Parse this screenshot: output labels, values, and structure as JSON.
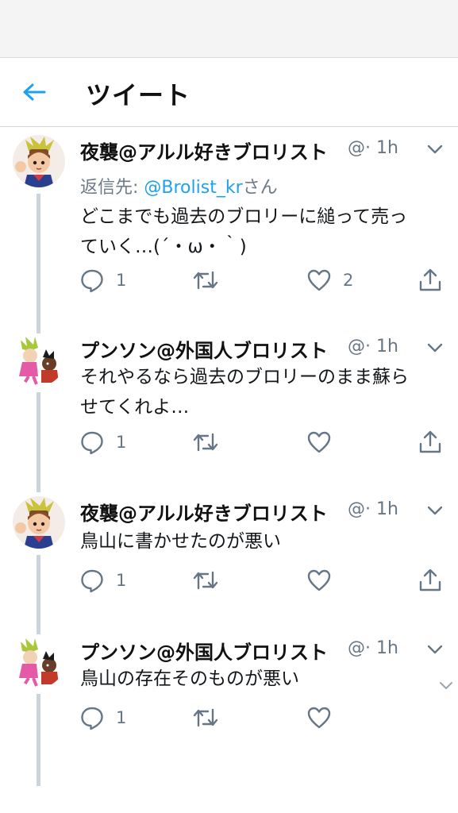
{
  "header": {
    "title": "ツイート"
  },
  "tweets": [
    {
      "name": "夜襲@アルル好きブロリスト",
      "handle": "@· 1h",
      "reply_prefix": "返信先: ",
      "reply_mention": "@Brolist_kr",
      "reply_suffix": "さん",
      "text_line1": "どこまでも過去のブロリーに縋って売っ",
      "text_line2": "ていく…(´・ω・｀)",
      "reply_count": "1",
      "retweet_count": "",
      "like_count": "2"
    },
    {
      "name": "プンソン@外国人ブロリスト",
      "handle": "@· 1h",
      "text_line1": "それやるなら過去のブロリーのまま蘇ら",
      "text_line2": "せてくれよ…",
      "reply_count": "1",
      "retweet_count": "",
      "like_count": ""
    },
    {
      "name": "夜襲@アルル好きブロリスト",
      "handle": "@· 1h",
      "text_line1": "鳥山に書かせたのが悪い",
      "reply_count": "1",
      "retweet_count": "",
      "like_count": ""
    },
    {
      "name": "プンソン@外国人ブロリスト",
      "handle": "@· 1h",
      "text_line1": "鳥山の存在そのものが悪い",
      "reply_count": "1",
      "retweet_count": "",
      "like_count": ""
    }
  ],
  "icons": {
    "back": "arrow-left-icon",
    "reply": "reply-bubble-icon",
    "retweet": "retweet-icon",
    "like": "heart-icon",
    "share": "share-icon",
    "more": "chevron-down-icon"
  },
  "colors": {
    "accent": "#1da1f2",
    "muted": "#657786",
    "thread_line": "#c9d4dc"
  }
}
